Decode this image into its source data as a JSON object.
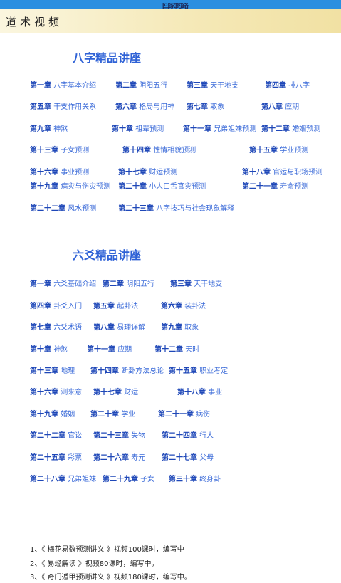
{
  "status_bar": {
    "partial_text": "回家的路"
  },
  "header": {
    "title": "道术视频"
  },
  "bazi": {
    "heading": "八字精品讲座",
    "chapters": [
      {
        "num": "第一章",
        "name": "八字基本介绍"
      },
      {
        "num": "第二章",
        "name": "阴阳五行"
      },
      {
        "num": "第三章",
        "name": "天干地支"
      },
      {
        "num": "第四章",
        "name": "排八字"
      },
      {
        "num": "第五章",
        "name": "干支作用关系"
      },
      {
        "num": "第六章",
        "name": "格局与用神"
      },
      {
        "num": "第七章",
        "name": "取象"
      },
      {
        "num": "第八章",
        "name": "应期"
      },
      {
        "num": "第九章",
        "name": "神煞"
      },
      {
        "num": "第十章",
        "name": "祖辈预测"
      },
      {
        "num": "第十一章",
        "name": "兄弟姐妹预测"
      },
      {
        "num": "第十二章",
        "name": "婚姻预测"
      },
      {
        "num": "第十三章",
        "name": "子女预测"
      },
      {
        "num": "第十四章",
        "name": "性情相貌预测"
      },
      {
        "num": "第十五章",
        "name": "学业预测"
      },
      {
        "num": "第十六章",
        "name": "事业预测"
      },
      {
        "num": "第十七章",
        "name": "财运预测"
      },
      {
        "num": "第十八章",
        "name": "官运与职场预测"
      },
      {
        "num": "第十九章",
        "name": "病灾与伤灾预测"
      },
      {
        "num": "第二十章",
        "name": "小人口舌官灾预测"
      },
      {
        "num": "第二十一章",
        "name": "寿命预测"
      },
      {
        "num": "第二十二章",
        "name": "风水预测"
      },
      {
        "num": "第二十三章",
        "name": "八字技巧与社会现象解释"
      }
    ]
  },
  "liuyao": {
    "heading": "六爻精品讲座",
    "chapters": [
      {
        "num": "第一章",
        "name": "六爻基础介绍"
      },
      {
        "num": "第二章",
        "name": "阴阳五行"
      },
      {
        "num": "第三章",
        "name": "天干地支"
      },
      {
        "num": "第四章",
        "name": "卦爻入门"
      },
      {
        "num": "第五章",
        "name": "起卦法"
      },
      {
        "num": "第六章",
        "name": "装卦法"
      },
      {
        "num": "第七章",
        "name": "六爻术语"
      },
      {
        "num": "第八章",
        "name": "易理详解"
      },
      {
        "num": "第九章",
        "name": "取象"
      },
      {
        "num": "第十章",
        "name": "神煞"
      },
      {
        "num": "第十一章",
        "name": "应期"
      },
      {
        "num": "第十二章",
        "name": "天时"
      },
      {
        "num": "第十三章",
        "name": "地理"
      },
      {
        "num": "第十四章",
        "name": "断卦方法总论"
      },
      {
        "num": "第十五章",
        "name": "职业考定"
      },
      {
        "num": "第十六章",
        "name": "测来意"
      },
      {
        "num": "第十七章",
        "name": "财运"
      },
      {
        "num": "第十八章",
        "name": "事业"
      },
      {
        "num": "第十九章",
        "name": "婚姻"
      },
      {
        "num": "第二十章",
        "name": "学业"
      },
      {
        "num": "第二十一章",
        "name": "病伤"
      },
      {
        "num": "第二十二章",
        "name": "官讼"
      },
      {
        "num": "第二十三章",
        "name": "失物"
      },
      {
        "num": "第二十四章",
        "name": "行人"
      },
      {
        "num": "第二十五章",
        "name": "彩票"
      },
      {
        "num": "第二十六章",
        "name": "寿元"
      },
      {
        "num": "第二十七章",
        "name": "父母"
      },
      {
        "num": "第二十八章",
        "name": "兄弟姐妹"
      },
      {
        "num": "第二十九章",
        "name": "子女"
      },
      {
        "num": "第三十章",
        "name": "终身卦"
      }
    ]
  },
  "notes": [
    "1、《 梅花易数预测讲义 》视频100课时，编写中",
    "2、《 易经解读 》视频80课时，编写中。",
    "3、《 奇门遁甲预测讲义 》视频180课时，编写中。"
  ]
}
